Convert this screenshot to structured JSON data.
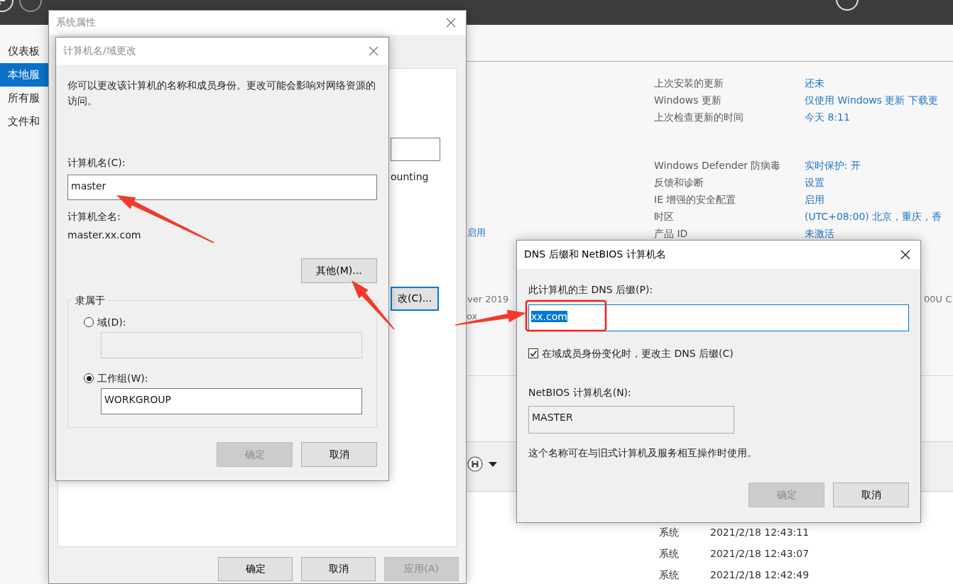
{
  "server_manager": {
    "sidebar": {
      "items": [
        {
          "label": "仪表板",
          "selected": false
        },
        {
          "label": "本地服",
          "selected": true
        },
        {
          "label": "所有服",
          "selected": false
        },
        {
          "label": "文件和",
          "selected": false
        }
      ]
    },
    "properties": {
      "groups": [
        {
          "rows": [
            {
              "label": "上次安装的更新",
              "value": "还未"
            },
            {
              "label": "Windows 更新",
              "value": "仅使用 Windows 更新 下载更"
            },
            {
              "label": "上次检查更新的时间",
              "value": "今天 8:11"
            }
          ]
        },
        {
          "rows": [
            {
              "label": "Windows Defender 防病毒",
              "value": "实时保护: 开"
            },
            {
              "label": "反馈和诊断",
              "value": "设置"
            },
            {
              "label": "IE 增强的安全配置",
              "value": "启用"
            },
            {
              "label": "时区",
              "value": "(UTC+08:00) 北京，重庆，香"
            },
            {
              "label": "产品 ID",
              "value": "未激活"
            }
          ]
        }
      ]
    },
    "fragments": [
      {
        "text": "启用",
        "kind": "link"
      },
      {
        "text": "ver 2019",
        "kind": "plain"
      },
      {
        "text": "ox",
        "kind": "plain"
      },
      {
        "text": "00U C",
        "kind": "plain"
      }
    ],
    "events": {
      "rows": [
        {
          "source": "系统",
          "time": "2021/2/18 12:43:11"
        },
        {
          "source": "系统",
          "time": "2021/2/18 12:43:07"
        },
        {
          "source": "系统",
          "time": "2021/2/18 12:42:49"
        }
      ]
    }
  },
  "system_properties": {
    "title": "系统属性",
    "active": false,
    "fragments": [
      {
        "kind": "field"
      },
      {
        "kind": "text",
        "text": "ounting"
      },
      {
        "kind": "button",
        "text": "改(C)...",
        "focused": true
      }
    ],
    "buttons": [
      {
        "label": "确定",
        "disabled": false
      },
      {
        "label": "取消",
        "disabled": false
      },
      {
        "label": "应用(A)",
        "disabled": true
      }
    ]
  },
  "computer_name_dialog": {
    "title": "计算机名/域更改",
    "active": false,
    "description": "你可以更改该计算机的名称和成员身份。更改可能会影响对网络资源的访问。",
    "computer_name": {
      "label": "计算机名(C):",
      "value": "master"
    },
    "full_name": {
      "label": "计算机全名:",
      "value": "master.xx.com"
    },
    "more_button": {
      "label": "其他(M)..."
    },
    "member_of": {
      "legend": "隶属于",
      "options": [
        {
          "label": "域(D):",
          "selected": false
        },
        {
          "label": "工作组(W):",
          "selected": true,
          "value": "WORKGROUP"
        }
      ]
    },
    "buttons": [
      {
        "label": "确定",
        "disabled": true
      },
      {
        "label": "取消",
        "disabled": false
      }
    ]
  },
  "dns_dialog": {
    "title": "DNS 后缀和 NetBIOS 计算机名",
    "active": true,
    "suffix": {
      "label": "此计算机的主 DNS 后缀(P):",
      "value": "xx.com",
      "text_selected": true
    },
    "change_on_membership": {
      "label": "在域成员身份变化时，更改主 DNS 后缀(C)",
      "checked": true
    },
    "netbios": {
      "label": "NetBIOS 计算机名(N):",
      "value": "MASTER"
    },
    "note": "这个名称可在与旧式计算机及服务相互操作时使用。",
    "buttons": [
      {
        "label": "确定",
        "disabled": true
      },
      {
        "label": "取消",
        "disabled": false
      }
    ]
  }
}
